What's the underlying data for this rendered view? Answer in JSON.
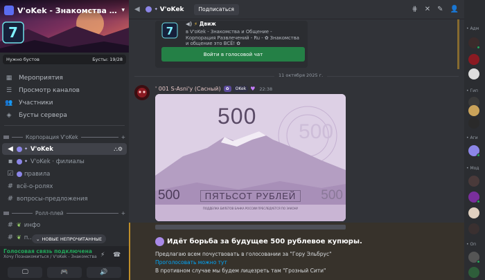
{
  "server": {
    "name": "V'oKek - Знакомства и Общение - К...",
    "boost_label": "Нужно бустов",
    "boost_count": "Бусты: 19/28",
    "boost_progress": 0.68
  },
  "nav": [
    {
      "icon": "calendar-icon",
      "label": "Мероприятия"
    },
    {
      "icon": "channels-icon",
      "label": "Просмотр каналов"
    },
    {
      "icon": "members-icon",
      "label": "Участники"
    },
    {
      "icon": "boost-icon",
      "label": "Бусты сервера"
    }
  ],
  "categories": {
    "corp": "Корпорация V'oKek",
    "roleplay": "Ролл-плей"
  },
  "channels": [
    {
      "type": "voice",
      "name": "V'oKek",
      "active": true
    },
    {
      "type": "text-dot",
      "name": "V'oKek · филиалы"
    },
    {
      "type": "rules",
      "name": "правила"
    },
    {
      "type": "hash",
      "name": "всё-о-ролях"
    },
    {
      "type": "forum",
      "name": "вопросы-предложения"
    }
  ],
  "rp_channels": [
    {
      "name": "инфо"
    },
    {
      "name": "п..."
    }
  ],
  "unread_pill": "НОВЫЕ НЕПРОЧИТАННЫЕ",
  "voice_status": {
    "title": "Голосовая связь подключена",
    "sub": "Хочу Познакомиться / V'oKek - Знакомства ..."
  },
  "topbar": {
    "channel": "V'oKek",
    "subscribe": "Подписаться"
  },
  "embed": {
    "header": "Движ",
    "desc_line1": "в V'oKek - Знакомства и Общение -",
    "desc_line2": "Корпорация Развлечений - Ru - ✿ Знакомства",
    "desc_line3": "и общение это ВСЁ! ✿",
    "join": "Войти в голосовой чат"
  },
  "date_divider": "11 октября 2025 г.",
  "message": {
    "author": "' 001 S-Asni'y (Сасный)",
    "tag1": "✿",
    "tag2": "OKek",
    "time": "22:38"
  },
  "banknote": {
    "value": "500",
    "text": "ПЯТЬСОТ РУБЛЕЙ",
    "small": "ПОДДЕЛКА БИЛЕТОВ БАНКА РОССИИ ПРЕСЛЕДУЕТСЯ ПО ЗАКОНУ"
  },
  "announcement": {
    "title": "Идёт борьба за будущее 500 рублевое купюры.",
    "line1": "Предлагаю всем почуствовать в голосовании за \"Гору Эльбрус\"",
    "link": "Проголосовать можно тут",
    "line2": "В противном случае мы будем лицезреть там \"Грозный Сити\""
  },
  "members": {
    "cats": [
      "Адм",
      "Гип",
      "Аги",
      "Мод",
      "Оп"
    ]
  },
  "colors": {
    "accent": "#5865f2",
    "green": "#248046",
    "link": "#00a8fc",
    "highlight": "#c08f2a"
  }
}
